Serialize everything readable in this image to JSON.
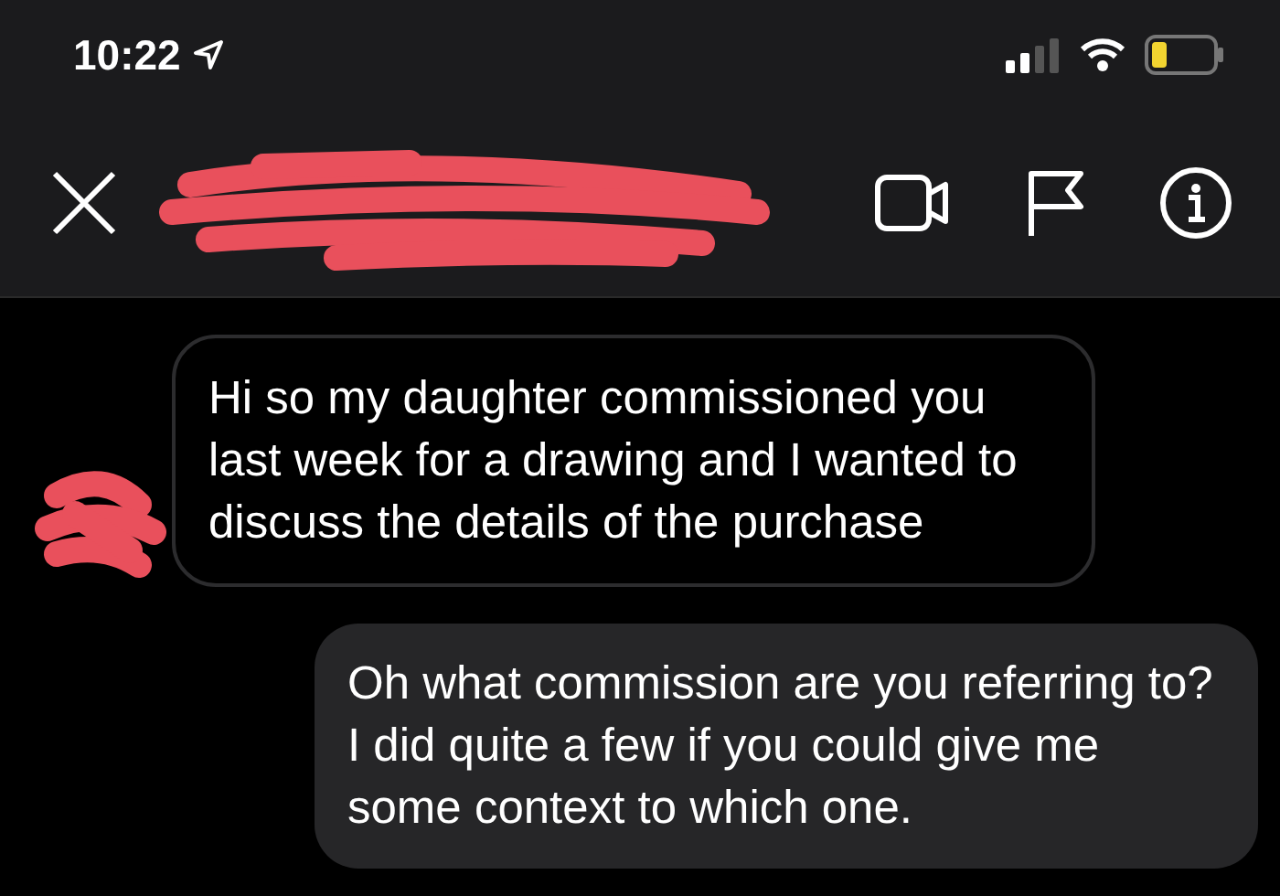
{
  "status_bar": {
    "time": "10:22"
  },
  "messages": [
    {
      "kind": "incoming",
      "text": "Hi so my daughter commissioned you last week for a drawing and I wanted to discuss the details of the purchase"
    },
    {
      "kind": "outgoing",
      "text": "Oh what commission are you referring to? I did quite a few if you could give me some context to which one."
    }
  ]
}
